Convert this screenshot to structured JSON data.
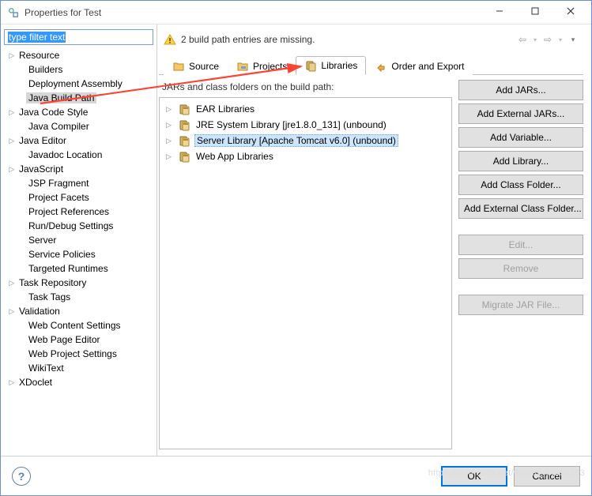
{
  "window": {
    "title": "Properties for Test"
  },
  "filter": {
    "placeholder": "type filter text"
  },
  "nav": {
    "items": [
      {
        "label": "Resource",
        "level": 1,
        "expandable": true,
        "selected": false
      },
      {
        "label": "Builders",
        "level": 2,
        "expandable": false,
        "selected": false
      },
      {
        "label": "Deployment Assembly",
        "level": 2,
        "expandable": false,
        "selected": false
      },
      {
        "label": "Java Build Path",
        "level": 2,
        "expandable": false,
        "selected": true
      },
      {
        "label": "Java Code Style",
        "level": 1,
        "expandable": true,
        "selected": false
      },
      {
        "label": "Java Compiler",
        "level": 2,
        "expandable": false,
        "selected": false
      },
      {
        "label": "Java Editor",
        "level": 1,
        "expandable": true,
        "selected": false
      },
      {
        "label": "Javadoc Location",
        "level": 2,
        "expandable": false,
        "selected": false
      },
      {
        "label": "JavaScript",
        "level": 1,
        "expandable": true,
        "selected": false
      },
      {
        "label": "JSP Fragment",
        "level": 2,
        "expandable": false,
        "selected": false
      },
      {
        "label": "Project Facets",
        "level": 2,
        "expandable": false,
        "selected": false
      },
      {
        "label": "Project References",
        "level": 2,
        "expandable": false,
        "selected": false
      },
      {
        "label": "Run/Debug Settings",
        "level": 2,
        "expandable": false,
        "selected": false
      },
      {
        "label": "Server",
        "level": 2,
        "expandable": false,
        "selected": false
      },
      {
        "label": "Service Policies",
        "level": 2,
        "expandable": false,
        "selected": false
      },
      {
        "label": "Targeted Runtimes",
        "level": 2,
        "expandable": false,
        "selected": false
      },
      {
        "label": "Task Repository",
        "level": 1,
        "expandable": true,
        "selected": false
      },
      {
        "label": "Task Tags",
        "level": 2,
        "expandable": false,
        "selected": false
      },
      {
        "label": "Validation",
        "level": 1,
        "expandable": true,
        "selected": false
      },
      {
        "label": "Web Content Settings",
        "level": 2,
        "expandable": false,
        "selected": false
      },
      {
        "label": "Web Page Editor",
        "level": 2,
        "expandable": false,
        "selected": false
      },
      {
        "label": "Web Project Settings",
        "level": 2,
        "expandable": false,
        "selected": false
      },
      {
        "label": "WikiText",
        "level": 2,
        "expandable": false,
        "selected": false
      },
      {
        "label": "XDoclet",
        "level": 1,
        "expandable": true,
        "selected": false
      }
    ]
  },
  "banner": {
    "message": "2 build path entries are missing."
  },
  "tabs": {
    "items": [
      {
        "label": "Source",
        "active": false,
        "icon": "folder-source"
      },
      {
        "label": "Projects",
        "active": false,
        "icon": "folder-projects"
      },
      {
        "label": "Libraries",
        "active": true,
        "icon": "jar-stack"
      },
      {
        "label": "Order and Export",
        "active": false,
        "icon": "order-arrows"
      }
    ]
  },
  "libraries": {
    "heading": "JARs and class folders on the build path:",
    "items": [
      {
        "label": "EAR Libraries",
        "selected": false
      },
      {
        "label": "JRE System Library [jre1.8.0_131] (unbound)",
        "selected": false
      },
      {
        "label": "Server Library [Apache Tomcat v6.0] (unbound)",
        "selected": true
      },
      {
        "label": "Web App Libraries",
        "selected": false
      }
    ]
  },
  "buttons": {
    "add_jars": "Add JARs...",
    "add_external_jars": "Add External JARs...",
    "add_variable": "Add Variable...",
    "add_library": "Add Library...",
    "add_class_folder": "Add Class Folder...",
    "add_external_class_folder": "Add External Class Folder...",
    "edit": "Edit...",
    "remove": "Remove",
    "migrate": "Migrate JAR File..."
  },
  "dialog": {
    "ok": "OK",
    "cancel": "Cancel"
  },
  "watermark": "https://blog.csdn.net/weixin_44599363"
}
